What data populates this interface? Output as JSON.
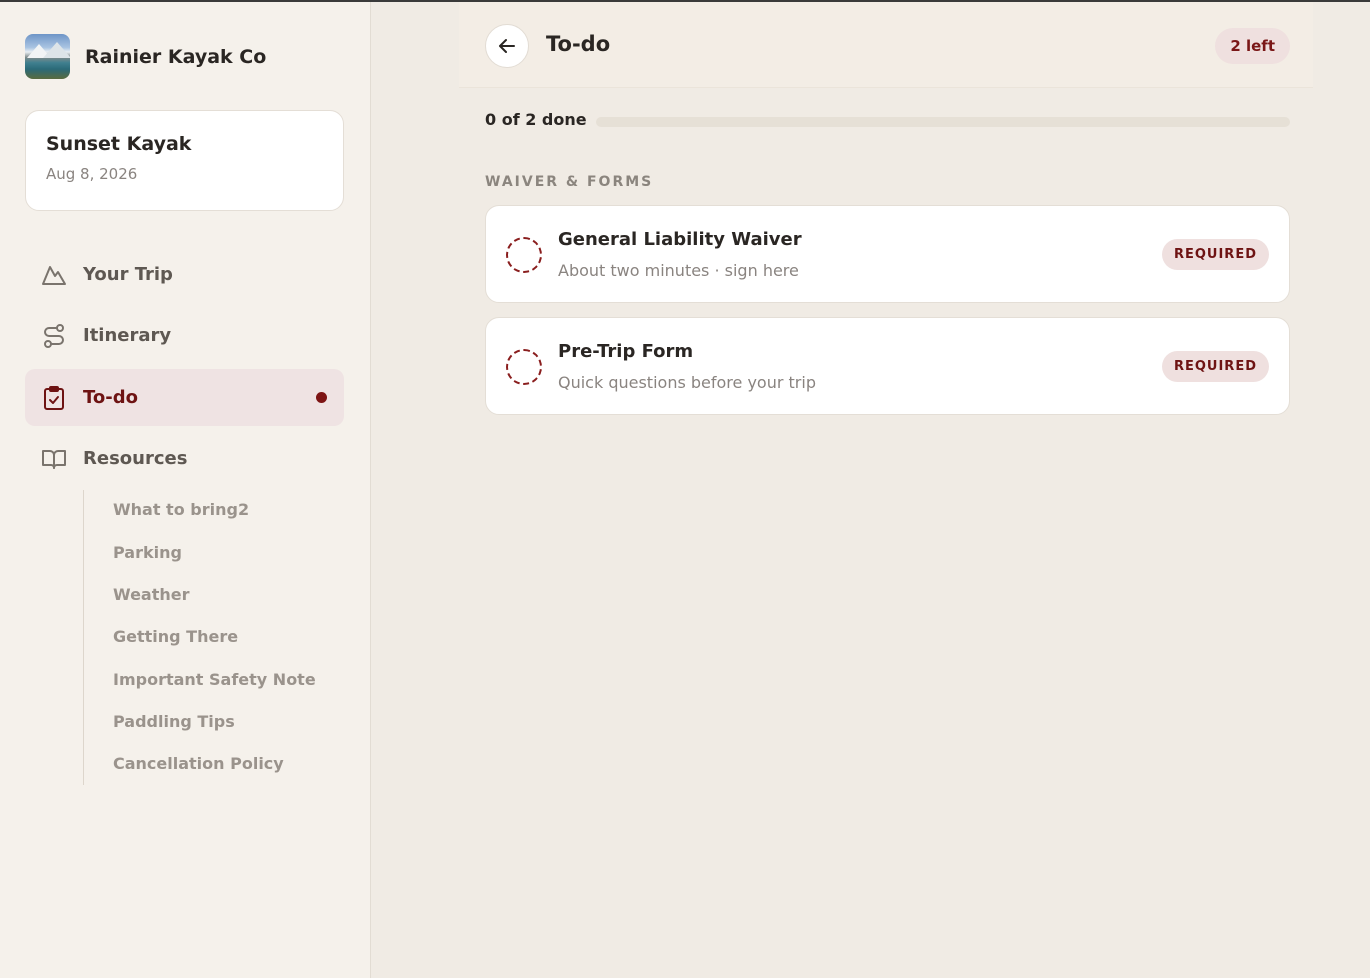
{
  "brand": {
    "name": "Rainier Kayak Co"
  },
  "trip": {
    "name": "Sunset Kayak",
    "date": "Aug 8, 2026"
  },
  "nav": {
    "items": [
      {
        "label": "Your Trip",
        "icon": "mountain-icon"
      },
      {
        "label": "Itinerary",
        "icon": "route-icon"
      },
      {
        "label": "To-do",
        "icon": "clipboard-check-icon",
        "active": true,
        "has_alert_dot": true
      },
      {
        "label": "Resources",
        "icon": "book-open-icon"
      }
    ],
    "resources": [
      "What to bring2",
      "Parking",
      "Weather",
      "Getting There",
      "Important Safety Note",
      "Paddling Tips",
      "Cancellation Policy"
    ]
  },
  "header": {
    "title": "To-do",
    "remaining_badge": "2 left",
    "back_icon": "arrow-left-icon"
  },
  "progress": {
    "label": "0 of 2 done",
    "completed": 0,
    "total": 2
  },
  "section": {
    "title": "WAIVER & FORMS"
  },
  "tasks": [
    {
      "title": "General Liability Waiver",
      "subtitle": "About two minutes · sign here",
      "badge": "REQUIRED",
      "done": false
    },
    {
      "title": "Pre-Trip Form",
      "subtitle": "Quick questions before your trip",
      "badge": "REQUIRED",
      "done": false
    }
  ],
  "colors": {
    "accent": "#7d1414",
    "accent_bg": "#efe0df",
    "sidebar_bg": "#f5f1eb",
    "page_bg": "#f0ebe4"
  }
}
